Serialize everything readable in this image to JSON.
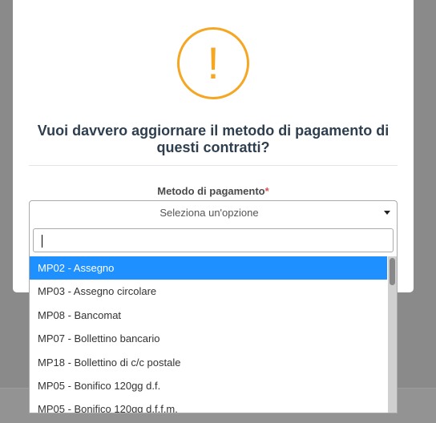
{
  "modal": {
    "icon": "exclamation-icon",
    "icon_glyph": "!",
    "title": "Vuoi davvero aggiornare il metodo di pagamento di questi contratti?",
    "accent_color": "#f5a623"
  },
  "payment_method": {
    "label": "Metodo di pagamento",
    "required_mark": "*",
    "selected_value": "Seleziona un'opzione",
    "search_value": "",
    "highlight_color": "#1e90ff",
    "options": [
      "MP02 - Assegno",
      "MP03 - Assegno circolare",
      "MP08 - Bancomat",
      "MP07 - Bollettino bancario",
      "MP18 - Bollettino di c/c postale",
      "MP05 - Bonifico 120gg d.f.",
      "MP05 - Bonifico 120gg d.f.f.m."
    ]
  }
}
